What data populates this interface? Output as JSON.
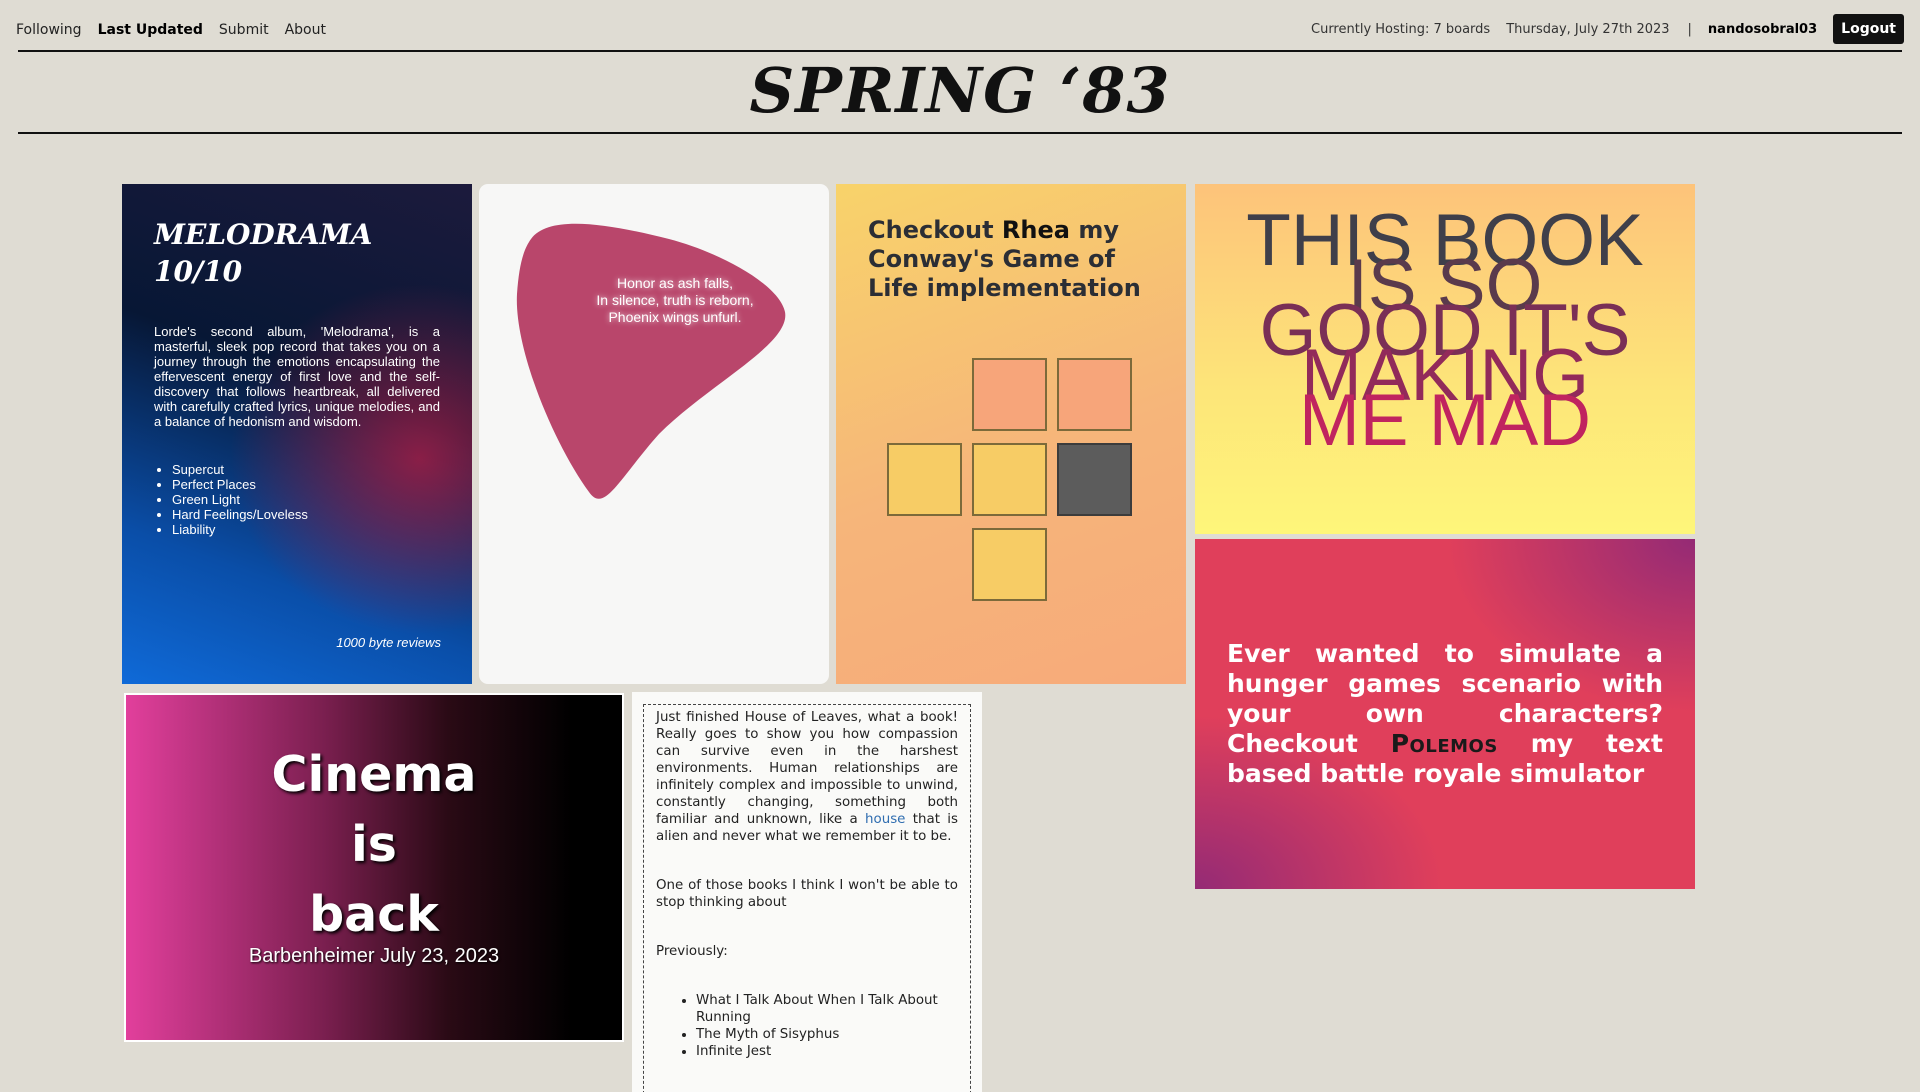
{
  "nav": {
    "following": "Following",
    "last_updated": "Last Updated",
    "submit": "Submit",
    "about": "About",
    "hosting": "Currently Hosting: 7 boards",
    "date": "Thursday, July 27th 2023",
    "separator": "|",
    "username": "nandosobral03",
    "logout": "Logout"
  },
  "site_title": "SPRING ‘83",
  "boards": {
    "melodrama": {
      "title_line1": "MELODRAMA",
      "title_line2": "10/10",
      "body": "Lorde's second album, 'Melodrama', is a masterful, sleek pop record that takes you on a journey through the emotions encapsulating the effervescent energy of first love and the self-discovery that follows heartbreak, all delivered with carefully crafted lyrics, unique melodies, and a balance of hedonism and wisdom.",
      "tracks": [
        "Supercut",
        "Perfect Places",
        "Green Light",
        "Hard Feelings/Loveless",
        "Liability"
      ],
      "credit": "1000 byte reviews"
    },
    "haiku": {
      "lines": [
        "Honor as ash falls,",
        "In silence, truth is reborn,",
        "Phoenix wings unfurl."
      ],
      "blob_color": "#b9466b"
    },
    "conway": {
      "title_pre": "Checkout ",
      "title_name": "Rhea",
      "title_post": " my Conway's Game of Life implementation",
      "cells": [
        {
          "row": 0,
          "col": 1,
          "state": "peach"
        },
        {
          "row": 0,
          "col": 2,
          "state": "peach"
        },
        {
          "row": 1,
          "col": 0,
          "state": "yellow"
        },
        {
          "row": 1,
          "col": 1,
          "state": "yellow"
        },
        {
          "row": 1,
          "col": 2,
          "state": "dark"
        },
        {
          "row": 2,
          "col": 1,
          "state": "yellow"
        }
      ]
    },
    "book": {
      "lines": [
        "THIS BOOK",
        "IS SO",
        "GOOD IT'S",
        "MAKING",
        "ME MAD"
      ],
      "colors": [
        "#3f3f4a",
        "#5a3a4c",
        "#7a2f56",
        "#922a5a",
        "#c0245f"
      ]
    },
    "polemos": {
      "text_pre": "Ever wanted to simulate a hunger games scenario with your own characters? Checkout ",
      "brand": "Polemos",
      "text_post": " my text based battle royale simulator"
    },
    "cinema": {
      "line1": "Cinema",
      "line2": "is",
      "line3": "back",
      "date": "Barbenheimer July 23, 2023"
    },
    "leaves": {
      "p1_pre": "Just finished House of Leaves, what a book! Really goes to show you how compassion can survive even in the harshest environments. Human relationships are infinitely complex and impossible to unwind, constantly changing, something both familiar and unknown, like a ",
      "p1_link": "house",
      "p1_post": " that is alien and never what we remember it to be.",
      "p2": "One of those books I think I won't be able to stop thinking about",
      "p3": "Previously:",
      "previous": [
        "What I Talk About When I Talk About Running",
        "The Myth of Sisyphus",
        "Infinite Jest"
      ]
    }
  }
}
